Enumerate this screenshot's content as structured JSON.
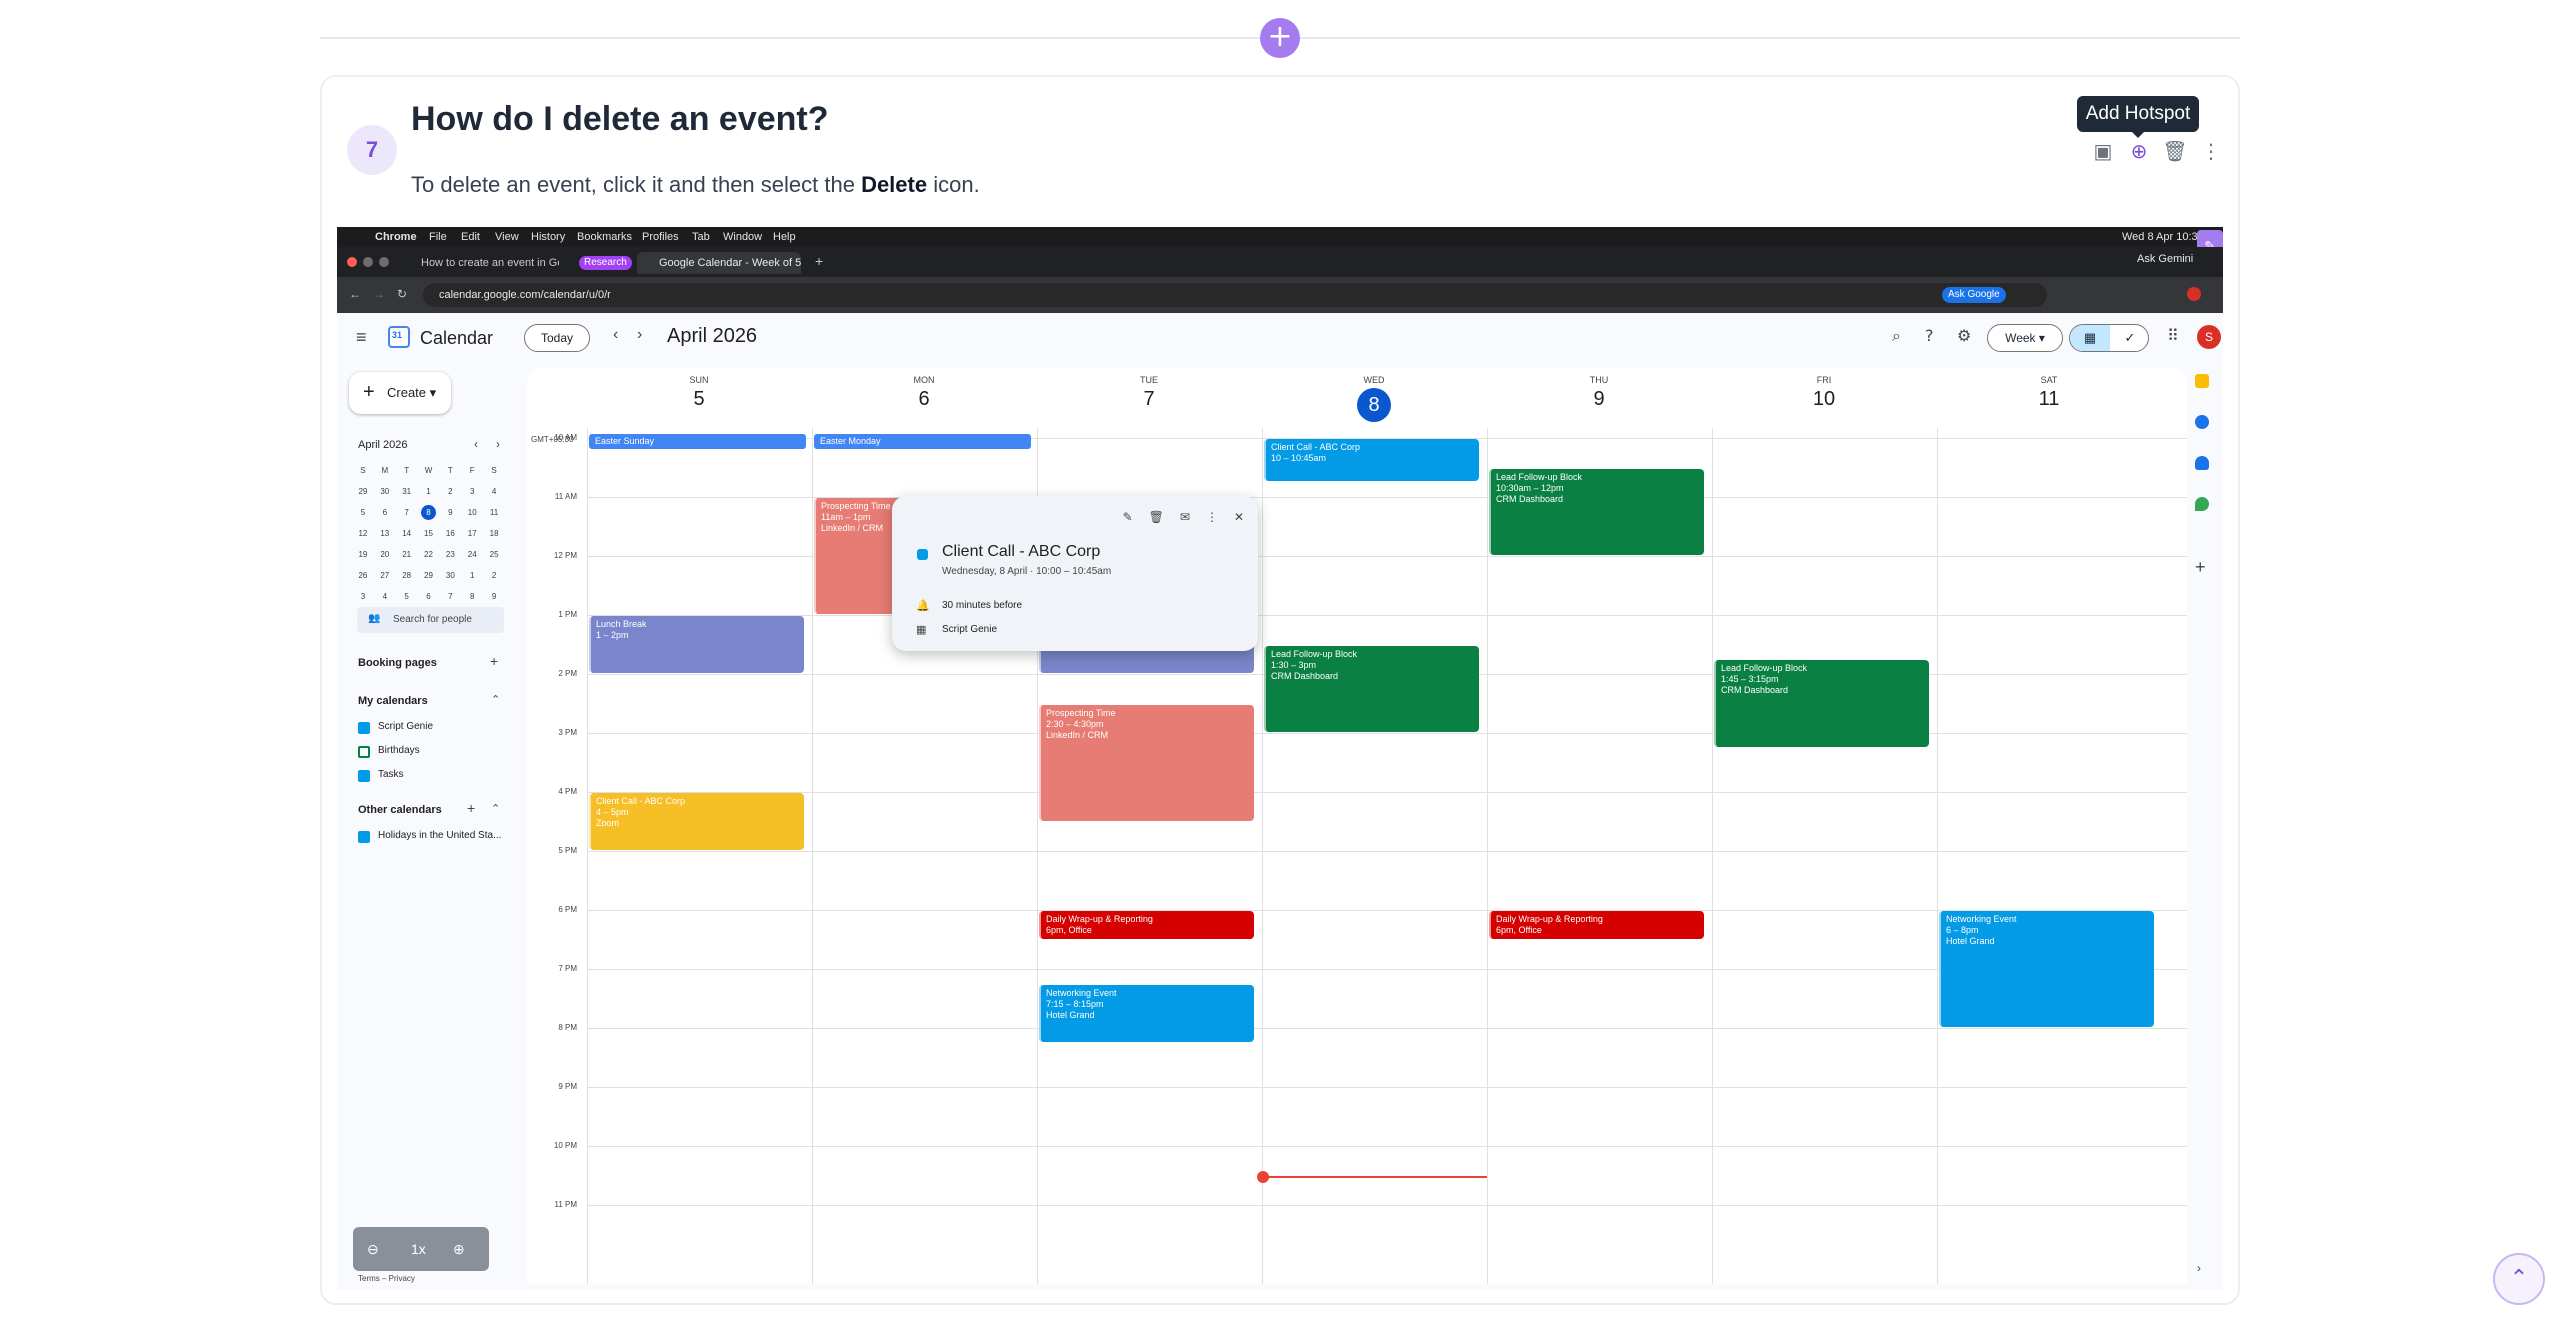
{
  "divider": {
    "plus_icon": "+"
  },
  "step": {
    "number": "7",
    "title": "How do I delete an event?",
    "desc_prefix": "To delete an event, click it and then select the ",
    "desc_bold": "Delete",
    "desc_suffix": " icon.",
    "tooltip": "Add Hotspot"
  },
  "mac_menu": {
    "app": "Chrome",
    "items": [
      "File",
      "Edit",
      "View",
      "History",
      "Bookmarks",
      "Profiles",
      "Tab",
      "Window",
      "Help"
    ],
    "datetime": "Wed 8 Apr  10:34"
  },
  "browser": {
    "tab1": "How to create an event in Go",
    "badge": "Research",
    "tab2": "Google Calendar - Week of 5",
    "url": "calendar.google.com/calendar/u/0/r",
    "ask_google": "Ask Google",
    "ask_gemini": "Ask Gemini"
  },
  "calendar": {
    "app_name": "Calendar",
    "today_label": "Today",
    "month_title": "April 2026",
    "view_label": "Week",
    "avatar": "S",
    "create_label": "Create",
    "timezone": "GMT+05:30",
    "mini": {
      "title": "April 2026",
      "dow": [
        "S",
        "M",
        "T",
        "W",
        "T",
        "F",
        "S"
      ],
      "weeks": [
        [
          "29",
          "30",
          "31",
          "1",
          "2",
          "3",
          "4"
        ],
        [
          "5",
          "6",
          "7",
          "8",
          "9",
          "10",
          "11"
        ],
        [
          "12",
          "13",
          "14",
          "15",
          "16",
          "17",
          "18"
        ],
        [
          "19",
          "20",
          "21",
          "22",
          "23",
          "24",
          "25"
        ],
        [
          "26",
          "27",
          "28",
          "29",
          "30",
          "1",
          "2"
        ],
        [
          "3",
          "4",
          "5",
          "6",
          "7",
          "8",
          "9"
        ]
      ]
    },
    "search_people": "Search for people",
    "booking_pages": "Booking pages",
    "my_calendars": "My calendars",
    "my_cal_items": [
      "Script Genie",
      "Birthdays",
      "Tasks"
    ],
    "other_calendars": "Other calendars",
    "other_items": [
      "Holidays in the United Sta..."
    ],
    "zoom_level": "1x",
    "terms": "Terms – Privacy",
    "days": [
      {
        "dow": "SUN",
        "num": "5"
      },
      {
        "dow": "MON",
        "num": "6"
      },
      {
        "dow": "TUE",
        "num": "7"
      },
      {
        "dow": "WED",
        "num": "8"
      },
      {
        "dow": "THU",
        "num": "9"
      },
      {
        "dow": "FRI",
        "num": "10"
      },
      {
        "dow": "SAT",
        "num": "11"
      }
    ],
    "hours": [
      "10 AM",
      "11 AM",
      "12 PM",
      "1 PM",
      "2 PM",
      "3 PM",
      "4 PM",
      "5 PM",
      "6 PM",
      "7 PM",
      "8 PM",
      "9 PM",
      "10 PM",
      "11 PM"
    ],
    "allday": [
      {
        "day": 0,
        "title": "Easter Sunday"
      },
      {
        "day": 1,
        "title": "Easter Monday"
      }
    ],
    "events": [
      {
        "day": 0,
        "title": "Lunch Break",
        "time": "1 – 2pm",
        "loc": "",
        "start": 13,
        "end": 14,
        "color": "#7986cb"
      },
      {
        "day": 0,
        "title": "Client Call - ABC Corp",
        "time": "4 – 5pm",
        "loc": "Zoom",
        "start": 16,
        "end": 17,
        "color": "#f6bf26"
      },
      {
        "day": 1,
        "title": "Prospecting Time",
        "time": "11am – 1pm",
        "loc": "LinkedIn / CRM",
        "start": 11,
        "end": 13,
        "color": "#e67c73"
      },
      {
        "day": 2,
        "title": "Lunch Break",
        "time": "1 – 2pm",
        "loc": "",
        "start": 13,
        "end": 14,
        "color": "#7986cb"
      },
      {
        "day": 2,
        "title": "Prospecting Time",
        "time": "2:30 – 4:30pm",
        "loc": "LinkedIn / CRM",
        "start": 14.5,
        "end": 16.5,
        "color": "#e67c73"
      },
      {
        "day": 2,
        "title": "Daily Wrap-up & Reporting",
        "time": "6pm, Office",
        "loc": "",
        "start": 18,
        "end": 18.5,
        "color": "#d50000"
      },
      {
        "day": 2,
        "title": "Networking Event",
        "time": "7:15 – 8:15pm",
        "loc": "Hotel Grand",
        "start": 19.25,
        "end": 20.25,
        "color": "#039be5"
      },
      {
        "day": 3,
        "title": "Client Call - ABC Corp",
        "time": "10 – 10:45am",
        "loc": "",
        "start": 10,
        "end": 10.75,
        "color": "#039be5"
      },
      {
        "day": 3,
        "title": "Lead Follow-up Block",
        "time": "1:30 – 3pm",
        "loc": "CRM Dashboard",
        "start": 13.5,
        "end": 15,
        "color": "#0b8043"
      },
      {
        "day": 4,
        "title": "Lead Follow-up Block",
        "time": "10:30am – 12pm",
        "loc": "CRM Dashboard",
        "start": 10.5,
        "end": 12,
        "color": "#0b8043"
      },
      {
        "day": 4,
        "title": "Daily Wrap-up & Reporting",
        "time": "6pm, Office",
        "loc": "",
        "start": 18,
        "end": 18.5,
        "color": "#d50000"
      },
      {
        "day": 5,
        "title": "Lead Follow-up Block",
        "time": "1:45 – 3:15pm",
        "loc": "CRM Dashboard",
        "start": 13.75,
        "end": 15.25,
        "color": "#0b8043"
      },
      {
        "day": 6,
        "title": "Networking Event",
        "time": "6 – 8pm",
        "loc": "Hotel Grand",
        "start": 18,
        "end": 20,
        "color": "#039be5"
      }
    ],
    "popover": {
      "title": "Client Call - ABC Corp",
      "when": "Wednesday, 8 April  ·  10:00 – 10:45am",
      "reminder": "30 minutes before",
      "calendar": "Script Genie"
    }
  }
}
